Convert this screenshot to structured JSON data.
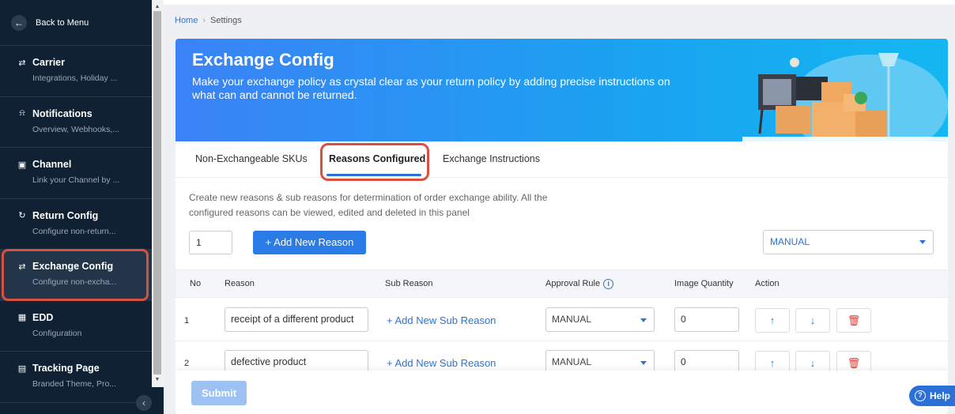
{
  "sidebar": {
    "back_label": "Back to Menu",
    "items": [
      {
        "icon": "carrier-icon",
        "title": "Carrier",
        "subtitle": "Integrations, Holiday ..."
      },
      {
        "icon": "bell-icon",
        "title": "Notifications",
        "subtitle": "Overview, Webhooks,..."
      },
      {
        "icon": "channel-icon",
        "title": "Channel",
        "subtitle": "Link your Channel by ..."
      },
      {
        "icon": "return-icon",
        "title": "Return Config",
        "subtitle": "Configure non-return..."
      },
      {
        "icon": "exchange-icon",
        "title": "Exchange Config",
        "subtitle": "Configure non-excha..."
      },
      {
        "icon": "calendar-icon",
        "title": "EDD",
        "subtitle": "Configuration"
      },
      {
        "icon": "tracking-icon",
        "title": "Tracking Page",
        "subtitle": "Branded Theme, Pro..."
      }
    ]
  },
  "breadcrumb": {
    "home": "Home",
    "current": "Settings"
  },
  "banner": {
    "title": "Exchange Config",
    "description": "Make your exchange policy as crystal clear as your return policy by adding precise instructions on what can and cannot be returned."
  },
  "tabs": [
    {
      "label": "Non-Exchangeable SKUs"
    },
    {
      "label": "Reasons Configured"
    },
    {
      "label": "Exchange Instructions"
    }
  ],
  "description": "Create new reasons & sub reasons for determination of order exchange ability. All the configured reasons can be viewed, edited and deleted in this panel",
  "controls": {
    "quantity_value": "1",
    "add_button": "+ Add New Reason",
    "mode_select": "MANUAL"
  },
  "table": {
    "headers": [
      "No",
      "Reason",
      "Sub Reason",
      "Approval Rule",
      "Image Quantity",
      "Action"
    ],
    "rows": [
      {
        "no": "1",
        "reason": "receipt of a different product",
        "sub_reason": "+ Add New Sub Reason",
        "approval_rule": "MANUAL",
        "image_quantity": "0"
      },
      {
        "no": "2",
        "reason": "defective product",
        "sub_reason": "+ Add New Sub Reason",
        "approval_rule": "MANUAL",
        "image_quantity": "0"
      }
    ]
  },
  "footer": {
    "submit": "Submit"
  },
  "help": {
    "label": "Help"
  },
  "colors": {
    "accent": "#2b7be6",
    "sidebar_bg": "#0f2133",
    "highlight": "#d9503f"
  }
}
